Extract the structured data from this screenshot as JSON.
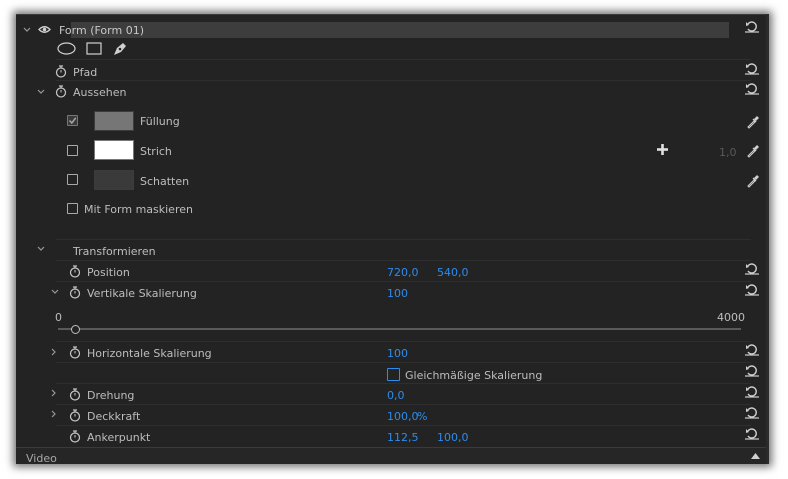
{
  "form_layer": {
    "title": "Form (Form 01)",
    "path_label": "Pfad",
    "appearance_label": "Aussehen",
    "fill_label": "Füllung",
    "fill_checked": true,
    "fill_color": "#767676",
    "stroke_label": "Strich",
    "stroke_checked": false,
    "stroke_color": "#ffffff",
    "stroke_width": "1,0",
    "shadow_label": "Schatten",
    "shadow_checked": false,
    "shadow_color": "#3a3a3a",
    "mask_label": "Mit Form maskieren",
    "mask_checked": false
  },
  "transform": {
    "label": "Transformieren",
    "position_label": "Position",
    "position_x": "720,0",
    "position_y": "540,0",
    "vertical_scale_label": "Vertikale Skalierung",
    "vertical_scale_value": "100",
    "slider_min": "0",
    "slider_max": "4000",
    "slider_value": 100,
    "horizontal_scale_label": "Horizontale Skalierung",
    "horizontal_scale_value": "100",
    "uniform_scale_label": "Gleichmäßige Skalierung",
    "uniform_scale_checked": false,
    "rotation_label": "Drehung",
    "rotation_value": "0,0",
    "opacity_label": "Deckkraft",
    "opacity_value": "100,0",
    "opacity_unit": "%",
    "anchor_label": "Ankerpunkt",
    "anchor_x": "112,5",
    "anchor_y": "100,0"
  },
  "footer": {
    "video_label": "Video"
  },
  "colors": {
    "panel_bg": "#232323",
    "value_blue": "#2d8ceb",
    "text": "#bdbdbd"
  },
  "icons": [
    "eye-icon",
    "ellipse-tool-icon",
    "rectangle-tool-icon",
    "pen-tool-icon",
    "stopwatch-icon",
    "reset-icon",
    "eyedropper-icon",
    "plus-icon",
    "chevron-icon"
  ]
}
